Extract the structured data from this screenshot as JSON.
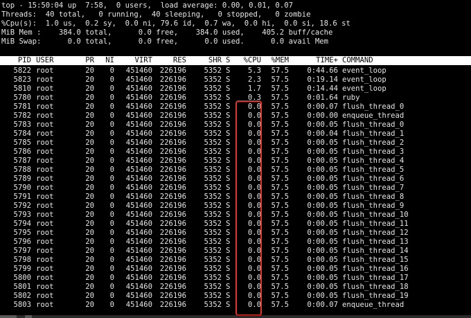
{
  "summary": {
    "line1": "top - 15:50:04 up  7:58,  0 users,  load average: 0.00, 0.01, 0.07",
    "line2": "Threads:  40 total,   0 running,  40 sleeping,   0 stopped,   0 zombie",
    "line3": "%Cpu(s):  1.0 us,  0.2 sy,  0.0 ni, 79.6 id,  0.7 wa,  0.0 hi,  0.0 si, 18.6 st",
    "line4": "MiB Mem :    384.0 total,      0.0 free,    384.0 used,    405.2 buff/cache",
    "line5": "MiB Swap:      0.0 total,      0.0 free,      0.0 used.      0.0 avail Mem"
  },
  "columns": {
    "pid": "PID",
    "user": "USER",
    "pr": "PR",
    "ni": "NI",
    "virt": "VIRT",
    "res": "RES",
    "shr": "SHR",
    "s": "S",
    "cpu": "%CPU",
    "mem": "%MEM",
    "time": "TIME+",
    "command": "COMMAND"
  },
  "processes": [
    {
      "pid": "5822",
      "user": "root",
      "pr": "20",
      "ni": "0",
      "virt": "451460",
      "res": "226196",
      "shr": "5352",
      "s": "S",
      "cpu": "5.3",
      "mem": "57.5",
      "time": "0:44.66",
      "command": "event_loop"
    },
    {
      "pid": "5823",
      "user": "root",
      "pr": "20",
      "ni": "0",
      "virt": "451460",
      "res": "226196",
      "shr": "5352",
      "s": "S",
      "cpu": "2.3",
      "mem": "57.5",
      "time": "0:19.14",
      "command": "event_loop"
    },
    {
      "pid": "5810",
      "user": "root",
      "pr": "20",
      "ni": "0",
      "virt": "451460",
      "res": "226196",
      "shr": "5352",
      "s": "S",
      "cpu": "1.7",
      "mem": "57.5",
      "time": "0:14.44",
      "command": "event_loop"
    },
    {
      "pid": "5780",
      "user": "root",
      "pr": "20",
      "ni": "0",
      "virt": "451460",
      "res": "226196",
      "shr": "5352",
      "s": "S",
      "cpu": "0.3",
      "mem": "57.5",
      "time": "0:01.64",
      "command": "ruby"
    },
    {
      "pid": "5781",
      "user": "root",
      "pr": "20",
      "ni": "0",
      "virt": "451460",
      "res": "226196",
      "shr": "5352",
      "s": "S",
      "cpu": "0.0",
      "mem": "57.5",
      "time": "0:00.07",
      "command": "flush_thread_0"
    },
    {
      "pid": "5782",
      "user": "root",
      "pr": "20",
      "ni": "0",
      "virt": "451460",
      "res": "226196",
      "shr": "5352",
      "s": "S",
      "cpu": "0.0",
      "mem": "57.5",
      "time": "0:00.00",
      "command": "enqueue_thread"
    },
    {
      "pid": "5783",
      "user": "root",
      "pr": "20",
      "ni": "0",
      "virt": "451460",
      "res": "226196",
      "shr": "5352",
      "s": "S",
      "cpu": "0.0",
      "mem": "57.5",
      "time": "0:00.05",
      "command": "flush_thread_0"
    },
    {
      "pid": "5784",
      "user": "root",
      "pr": "20",
      "ni": "0",
      "virt": "451460",
      "res": "226196",
      "shr": "5352",
      "s": "S",
      "cpu": "0.0",
      "mem": "57.5",
      "time": "0:00.04",
      "command": "flush_thread_1"
    },
    {
      "pid": "5785",
      "user": "root",
      "pr": "20",
      "ni": "0",
      "virt": "451460",
      "res": "226196",
      "shr": "5352",
      "s": "S",
      "cpu": "0.0",
      "mem": "57.5",
      "time": "0:00.05",
      "command": "flush_thread_2"
    },
    {
      "pid": "5786",
      "user": "root",
      "pr": "20",
      "ni": "0",
      "virt": "451460",
      "res": "226196",
      "shr": "5352",
      "s": "S",
      "cpu": "0.0",
      "mem": "57.5",
      "time": "0:00.05",
      "command": "flush_thread_3"
    },
    {
      "pid": "5787",
      "user": "root",
      "pr": "20",
      "ni": "0",
      "virt": "451460",
      "res": "226196",
      "shr": "5352",
      "s": "S",
      "cpu": "0.0",
      "mem": "57.5",
      "time": "0:00.05",
      "command": "flush_thread_4"
    },
    {
      "pid": "5788",
      "user": "root",
      "pr": "20",
      "ni": "0",
      "virt": "451460",
      "res": "226196",
      "shr": "5352",
      "s": "S",
      "cpu": "0.0",
      "mem": "57.5",
      "time": "0:00.05",
      "command": "flush_thread_5"
    },
    {
      "pid": "5789",
      "user": "root",
      "pr": "20",
      "ni": "0",
      "virt": "451460",
      "res": "226196",
      "shr": "5352",
      "s": "S",
      "cpu": "0.0",
      "mem": "57.5",
      "time": "0:00.05",
      "command": "flush_thread_6"
    },
    {
      "pid": "5790",
      "user": "root",
      "pr": "20",
      "ni": "0",
      "virt": "451460",
      "res": "226196",
      "shr": "5352",
      "s": "S",
      "cpu": "0.0",
      "mem": "57.5",
      "time": "0:00.05",
      "command": "flush_thread_7"
    },
    {
      "pid": "5791",
      "user": "root",
      "pr": "20",
      "ni": "0",
      "virt": "451460",
      "res": "226196",
      "shr": "5352",
      "s": "S",
      "cpu": "0.0",
      "mem": "57.5",
      "time": "0:00.05",
      "command": "flush_thread_8"
    },
    {
      "pid": "5792",
      "user": "root",
      "pr": "20",
      "ni": "0",
      "virt": "451460",
      "res": "226196",
      "shr": "5352",
      "s": "S",
      "cpu": "0.0",
      "mem": "57.5",
      "time": "0:00.05",
      "command": "flush_thread_9"
    },
    {
      "pid": "5793",
      "user": "root",
      "pr": "20",
      "ni": "0",
      "virt": "451460",
      "res": "226196",
      "shr": "5352",
      "s": "S",
      "cpu": "0.0",
      "mem": "57.5",
      "time": "0:00.05",
      "command": "flush_thread_10"
    },
    {
      "pid": "5794",
      "user": "root",
      "pr": "20",
      "ni": "0",
      "virt": "451460",
      "res": "226196",
      "shr": "5352",
      "s": "S",
      "cpu": "0.0",
      "mem": "57.5",
      "time": "0:00.05",
      "command": "flush_thread_11"
    },
    {
      "pid": "5795",
      "user": "root",
      "pr": "20",
      "ni": "0",
      "virt": "451460",
      "res": "226196",
      "shr": "5352",
      "s": "S",
      "cpu": "0.0",
      "mem": "57.5",
      "time": "0:00.05",
      "command": "flush_thread_12"
    },
    {
      "pid": "5796",
      "user": "root",
      "pr": "20",
      "ni": "0",
      "virt": "451460",
      "res": "226196",
      "shr": "5352",
      "s": "S",
      "cpu": "0.0",
      "mem": "57.5",
      "time": "0:00.05",
      "command": "flush_thread_13"
    },
    {
      "pid": "5797",
      "user": "root",
      "pr": "20",
      "ni": "0",
      "virt": "451460",
      "res": "226196",
      "shr": "5352",
      "s": "S",
      "cpu": "0.0",
      "mem": "57.5",
      "time": "0:00.05",
      "command": "flush_thread_14"
    },
    {
      "pid": "5798",
      "user": "root",
      "pr": "20",
      "ni": "0",
      "virt": "451460",
      "res": "226196",
      "shr": "5352",
      "s": "S",
      "cpu": "0.0",
      "mem": "57.5",
      "time": "0:00.05",
      "command": "flush_thread_15"
    },
    {
      "pid": "5799",
      "user": "root",
      "pr": "20",
      "ni": "0",
      "virt": "451460",
      "res": "226196",
      "shr": "5352",
      "s": "S",
      "cpu": "0.0",
      "mem": "57.5",
      "time": "0:00.05",
      "command": "flush_thread_16"
    },
    {
      "pid": "5800",
      "user": "root",
      "pr": "20",
      "ni": "0",
      "virt": "451460",
      "res": "226196",
      "shr": "5352",
      "s": "S",
      "cpu": "0.0",
      "mem": "57.5",
      "time": "0:00.05",
      "command": "flush_thread_17"
    },
    {
      "pid": "5801",
      "user": "root",
      "pr": "20",
      "ni": "0",
      "virt": "451460",
      "res": "226196",
      "shr": "5352",
      "s": "S",
      "cpu": "0.0",
      "mem": "57.5",
      "time": "0:00.05",
      "command": "flush_thread_18"
    },
    {
      "pid": "5802",
      "user": "root",
      "pr": "20",
      "ni": "0",
      "virt": "451460",
      "res": "226196",
      "shr": "5352",
      "s": "S",
      "cpu": "0.0",
      "mem": "57.5",
      "time": "0:00.05",
      "command": "flush_thread_19"
    },
    {
      "pid": "5803",
      "user": "root",
      "pr": "20",
      "ni": "0",
      "virt": "451460",
      "res": "226196",
      "shr": "5352",
      "s": "S",
      "cpu": "0.0",
      "mem": "57.5",
      "time": "0:00.07",
      "command": "enqueue_thread"
    }
  ],
  "colors": {
    "background": "#000000",
    "text": "#e6e6e6",
    "header_background": "#ffffff",
    "header_text": "#000000",
    "highlight_border": "#e0352b"
  }
}
